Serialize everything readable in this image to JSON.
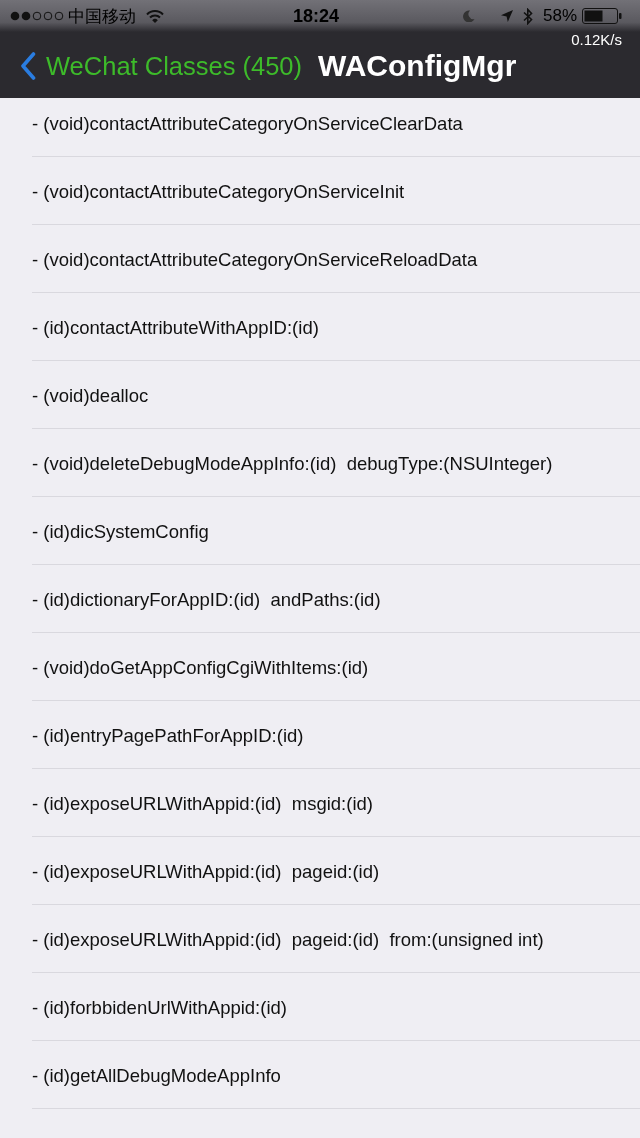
{
  "status_bar": {
    "carrier": "中国移动",
    "time": "18:24",
    "battery_percent": "58%"
  },
  "nav_bar": {
    "network_speed": "0.12K/s",
    "back_label": "WeChat Classes (450)",
    "title": "WAConfigMgr"
  },
  "methods": [
    "- (void)contactAttributeCategoryOnServiceClearData",
    "- (void)contactAttributeCategoryOnServiceInit",
    "- (void)contactAttributeCategoryOnServiceReloadData",
    "- (id)contactAttributeWithAppID:(id)",
    "- (void)dealloc",
    "- (void)deleteDebugModeAppInfo:(id)  debugType:(NSUInteger)",
    "- (id)dicSystemConfig",
    "- (id)dictionaryForAppID:(id)  andPaths:(id)",
    "- (void)doGetAppConfigCgiWithItems:(id)",
    "- (id)entryPagePathForAppID:(id)",
    "- (id)exposeURLWithAppid:(id)  msgid:(id)",
    "- (id)exposeURLWithAppid:(id)  pageid:(id)",
    "- (id)exposeURLWithAppid:(id)  pageid:(id)  from:(unsigned int)",
    "- (id)forbbidenUrlWithAppid:(id)",
    "- (id)getAllDebugModeAppInfo"
  ]
}
